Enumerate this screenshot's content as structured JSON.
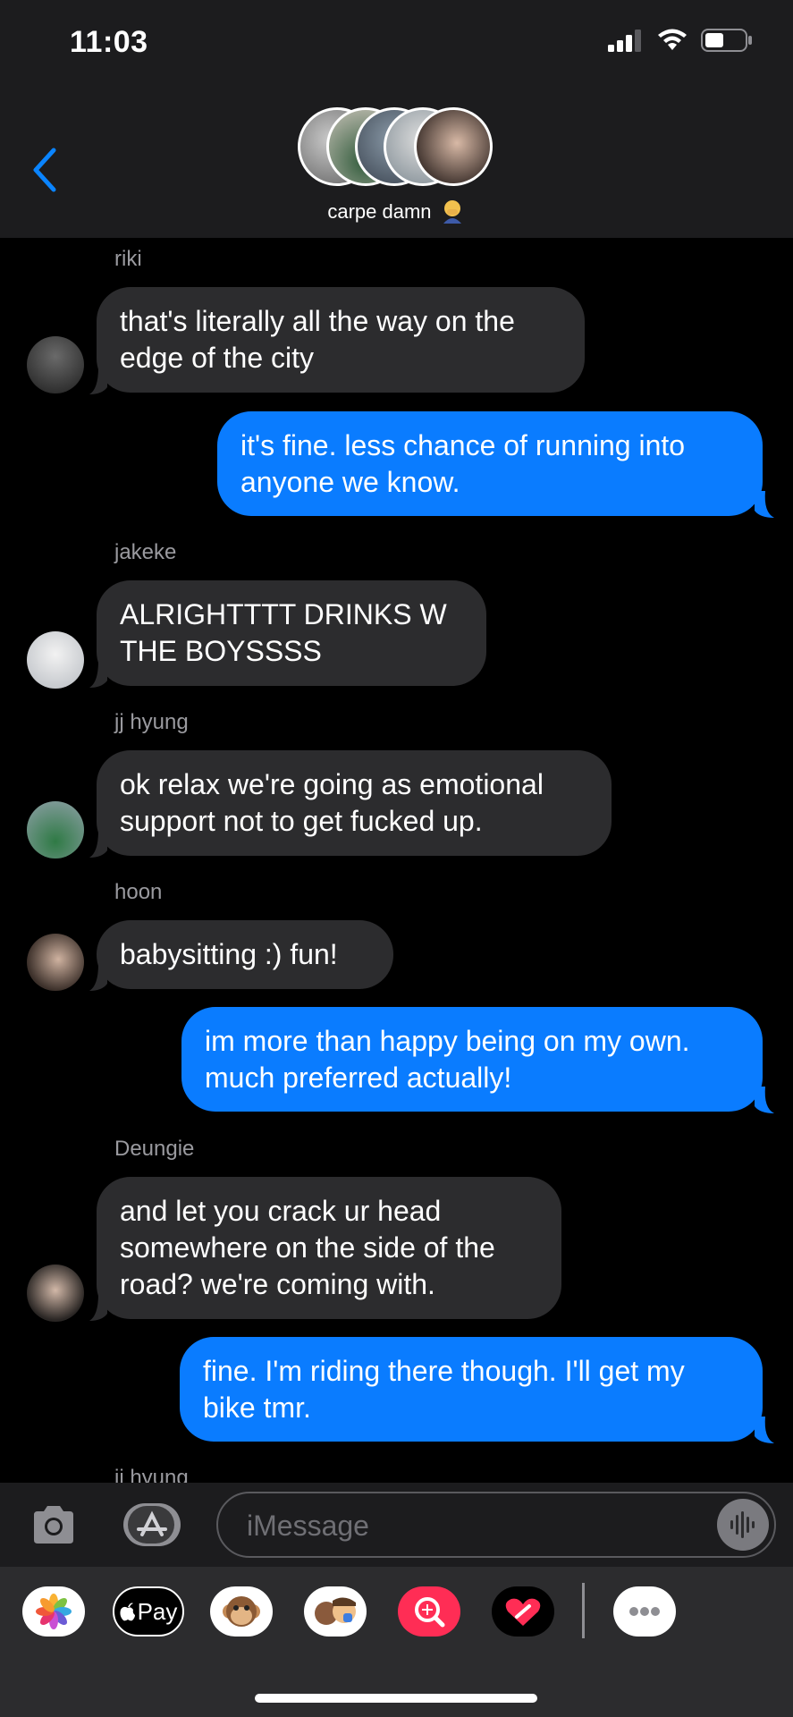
{
  "status_bar": {
    "time": "11:03"
  },
  "header": {
    "group_name": "carpe damn",
    "group_emoji": "face-with-hand-over-mouth-emoji"
  },
  "colors": {
    "incoming_bubble": "#2c2c2e",
    "outgoing_bubble": "#0a7cff",
    "accent": "#0a84ff"
  },
  "messages": [
    {
      "sender": "riki",
      "direction": "incoming",
      "text": "that's literally all the way on the\nedge of the city"
    },
    {
      "sender": "",
      "direction": "outgoing",
      "text": "it's fine. less chance of running into\nanyone we know."
    },
    {
      "sender": "jakeke",
      "direction": "incoming",
      "text": "ALRIGHTTTT DRINKS W\nTHE BOYSSSS"
    },
    {
      "sender": "jj hyung",
      "direction": "incoming",
      "text": "ok relax we're going as emotional\nsupport not to get fucked up."
    },
    {
      "sender": "hoon",
      "direction": "incoming",
      "text": "babysitting :) fun!"
    },
    {
      "sender": "",
      "direction": "outgoing",
      "text": "im more than happy being on my own.\nmuch preferred actually!"
    },
    {
      "sender": "Deungie",
      "direction": "incoming",
      "text": "and let you crack ur head\nsomewhere on the side of the\nroad? we're coming with."
    },
    {
      "sender": "",
      "direction": "outgoing",
      "text": "fine. I'm riding there though. I'll get my\nbike tmr."
    },
    {
      "sender": "jj hyung",
      "direction": "incoming",
      "text": ""
    }
  ],
  "input": {
    "placeholder": "iMessage"
  },
  "app_drawer": [
    {
      "name": "photos-app-icon"
    },
    {
      "name": "apple-pay-icon",
      "label": "Pay"
    },
    {
      "name": "animoji-icon"
    },
    {
      "name": "memoji-icon"
    },
    {
      "name": "image-search-icon"
    },
    {
      "name": "digital-touch-icon"
    },
    {
      "name": "more-apps-icon"
    }
  ]
}
